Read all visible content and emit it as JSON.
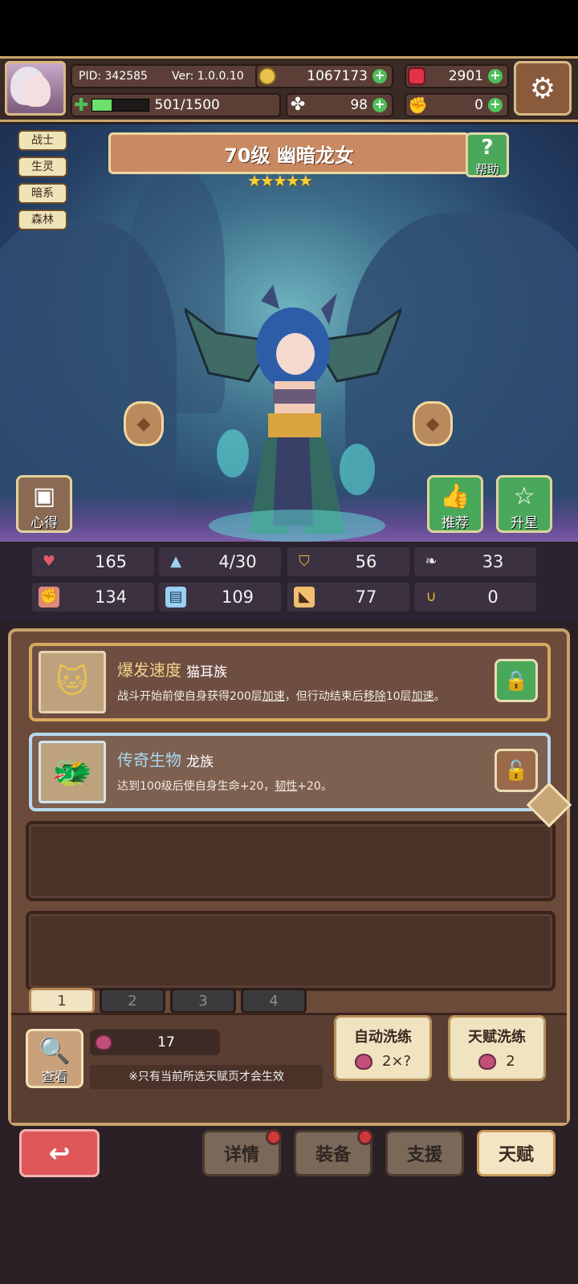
{
  "header": {
    "pid": "PID: 342585",
    "version": "Ver: 1.0.0.10",
    "gold": "1067173",
    "gems": "2901",
    "energy": "501/1500",
    "energy_fraction": 0.334,
    "clover": "98",
    "tokens": "0"
  },
  "tags": [
    "战士",
    "生灵",
    "暗系",
    "森林"
  ],
  "hero": {
    "title": "70级  幽暗龙女",
    "stars": 5,
    "help_label": "帮助"
  },
  "scene_buttons": {
    "insight": "心得",
    "recommend": "推荐",
    "star_up": "升星"
  },
  "stats": {
    "hp": "165",
    "mana": "4/30",
    "defense": "56",
    "speed": "33",
    "attack": "134",
    "magic": "109",
    "agility": "77",
    "luck": "0"
  },
  "talents": [
    {
      "name": "爆发速度",
      "race": "猫耳族",
      "desc_parts": [
        "战斗开始前使自身获得200层",
        "加速",
        "，但行动结束后",
        "移除",
        "10层",
        "加速",
        "。"
      ],
      "icon": "cat-icon",
      "locked": true
    },
    {
      "name": "传奇生物",
      "race": "龙族",
      "desc_parts": [
        "达到100级后使自身生命+20，",
        "韧性",
        "+20。"
      ],
      "icon": "dragon-icon",
      "locked": false
    }
  ],
  "pages": [
    "1",
    "2",
    "3",
    "4"
  ],
  "bottom": {
    "look_label": "查看",
    "fruit_count": "17",
    "note": "※只有当前所选天赋页才会生效",
    "auto_reroll_label": "自动洗练",
    "auto_reroll_cost": "2×?",
    "talent_reroll_label": "天赋洗练",
    "talent_reroll_cost": "2"
  },
  "nav": {
    "details": "详情",
    "equipment": "装备",
    "support": "支援",
    "talent": "天赋"
  }
}
